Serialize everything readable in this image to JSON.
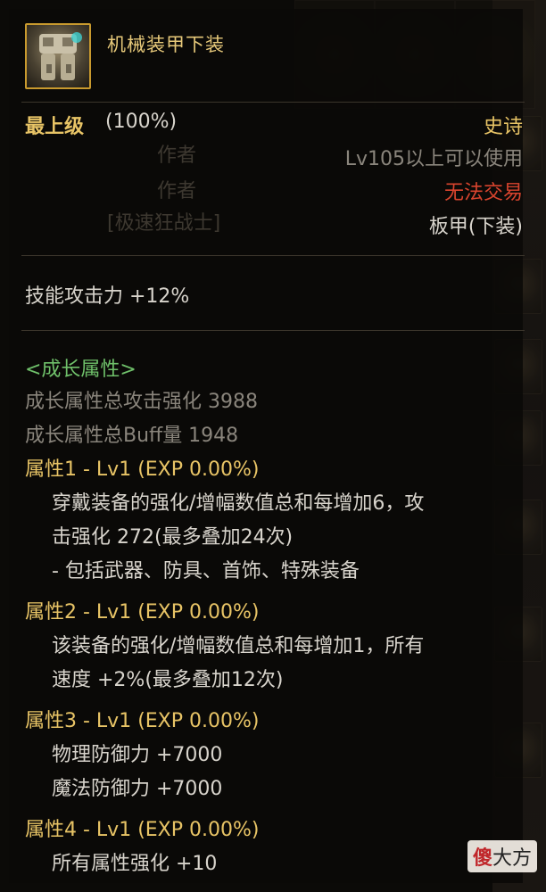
{
  "item": {
    "name": "机械装甲下装",
    "grade_label": "最上级",
    "grade_percent": "(100%)",
    "rarity": "史诗",
    "level_req": "Lv105以上可以使用",
    "trade": "无法交易",
    "type": "板甲(下装)"
  },
  "ghost": {
    "author1": "作者",
    "author2": "作者",
    "tag": "[极速狂战士]"
  },
  "stats": {
    "skill_attack": "技能攻击力  +12%"
  },
  "growth": {
    "header": "<成长属性>",
    "total_attack": "成长属性总攻击强化 3988",
    "total_buff": "成长属性总Buff量 1948",
    "attrs": [
      {
        "title": "属性1 - Lv1 (EXP 0.00%)",
        "lines": [
          "穿戴装备的强化/增幅数值总和每增加6，攻",
          "击强化 272(最多叠加24次)",
          "- 包括武器、防具、首饰、特殊装备"
        ]
      },
      {
        "title": "属性2 - Lv1 (EXP 0.00%)",
        "lines": [
          "该装备的强化/增幅数值总和每增加1，所有",
          "速度 +2%(最多叠加12次)"
        ]
      },
      {
        "title": "属性3 - Lv1 (EXP 0.00%)",
        "lines": [
          "物理防御力 +7000",
          "魔法防御力 +7000"
        ]
      },
      {
        "title": "属性4 - Lv1 (EXP 0.00%)",
        "lines": [
          "所有属性强化 +10"
        ]
      }
    ]
  },
  "watermark": {
    "a": "傻",
    "b": "大方"
  },
  "colors": {
    "gold": "#e8c466",
    "white": "#d8d4cc",
    "gray": "#8a857c",
    "red": "#d8442e",
    "green": "#6fc06a"
  }
}
